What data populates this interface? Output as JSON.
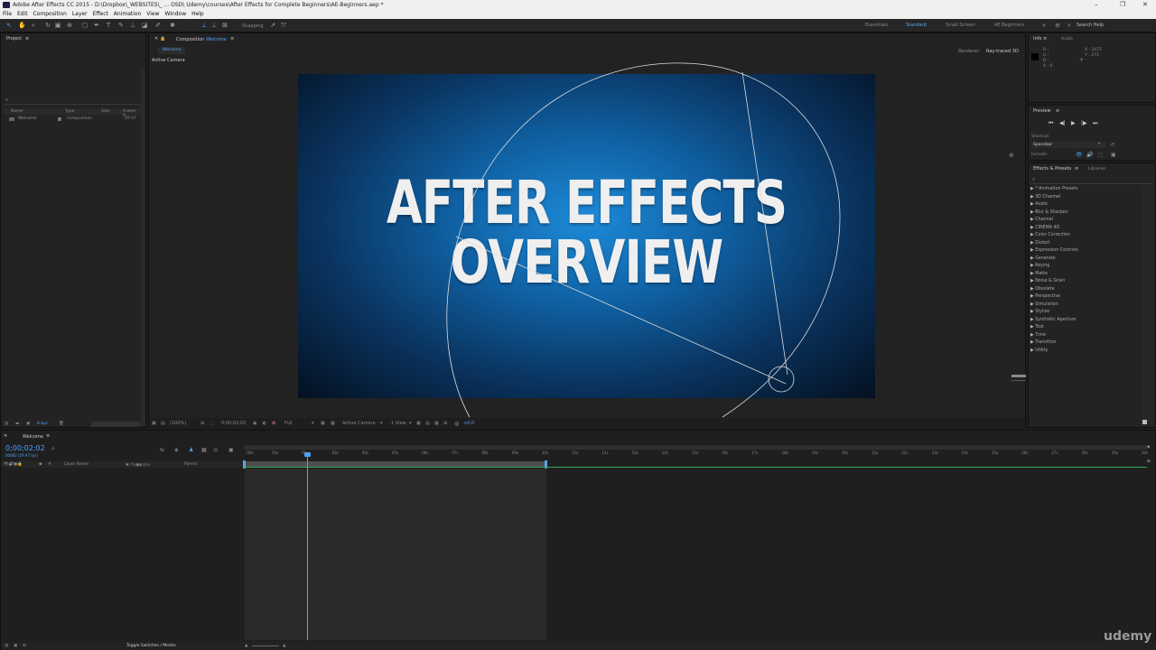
{
  "window": {
    "title": "Adobe After Effects CC 2015 - D:\\Dropbox\\_WEBSITES\\_ ... OSD\\ Udemy\\courses\\After Effects for Complete Beginners\\AE-Beginners.aep *",
    "controls": [
      "–",
      "❐",
      "✕"
    ]
  },
  "menu": [
    "File",
    "Edit",
    "Composition",
    "Layer",
    "Effect",
    "Animation",
    "View",
    "Window",
    "Help"
  ],
  "toolbar": {
    "snapping_label": "Snapping",
    "workspaces": [
      "Essentials",
      "Standard",
      "Small Screen",
      "AE Beginners"
    ],
    "active_workspace": "Standard",
    "search_help": "Search Help"
  },
  "project": {
    "title": "Project",
    "columns": [
      "Name",
      "Type",
      "Size",
      "Frame R..."
    ],
    "items": [
      {
        "name": "Welcome",
        "type": "Composition",
        "fps": "29.97"
      }
    ],
    "bpc": "8 bpc"
  },
  "composition": {
    "panel_title": "Composition",
    "comp_name": "Welcome",
    "tab": "Welcome",
    "view_label": "Active Camera",
    "renderer_label": "Renderer:",
    "renderer_value": "Ray-traced 3D",
    "headline_line1": "AFTER EFFECTS",
    "headline_line2": "OVERVIEW",
    "footer": {
      "zoom": "(100%)",
      "timecode": "0;00;02;02",
      "resolution": "Full",
      "camera": "Active Camera",
      "views": "1 View",
      "exposure": "+0.0"
    }
  },
  "info": {
    "tab": "Info",
    "tab2": "Audio",
    "channels": [
      "R :",
      "G :",
      "B :",
      "A : 0"
    ],
    "x": "X : 2475",
    "y": "Y : 273"
  },
  "preview": {
    "title": "Preview",
    "shortcut_label": "Shortcut",
    "shortcut_value": "Spacebar",
    "include_label": "Include:"
  },
  "effects": {
    "tab": "Effects & Presets",
    "tab2": "Libraries",
    "items": [
      "* Animation Presets",
      "3D Channel",
      "Audio",
      "Blur & Sharpen",
      "Channel",
      "CINEMA 4D",
      "Color Correction",
      "Distort",
      "Expression Controls",
      "Generate",
      "Keying",
      "Matte",
      "Noise & Grain",
      "Obsolete",
      "Perspective",
      "Simulation",
      "Stylize",
      "Synthetic Aperture",
      "Text",
      "Time",
      "Transition",
      "Utility"
    ]
  },
  "timeline": {
    "tab": "Welcome",
    "timecode": "0;00;02;02",
    "frame_info": "00062 (29.97 fps)",
    "layer_name_header": "Layer Name",
    "parent_header": "Parent",
    "ruler": [
      ":00s",
      "01s",
      "02s",
      "03s",
      "04s",
      "05s",
      "06s",
      "07s",
      "08s",
      "09s",
      "10s",
      "11s",
      "12s",
      "13s",
      "14s",
      "15s",
      "16s",
      "17s",
      "18s",
      "19s",
      "20s",
      "21s",
      "22s",
      "23s",
      "24s",
      "25s",
      "26s",
      "27s",
      "28s",
      "29s",
      "30s"
    ],
    "toggle_label": "Toggle Switches / Modes"
  },
  "watermark": "udemy",
  "colors": {
    "accent": "#2d8ceb",
    "panel": "#232323",
    "comp_blue": "#1d8ad8"
  }
}
